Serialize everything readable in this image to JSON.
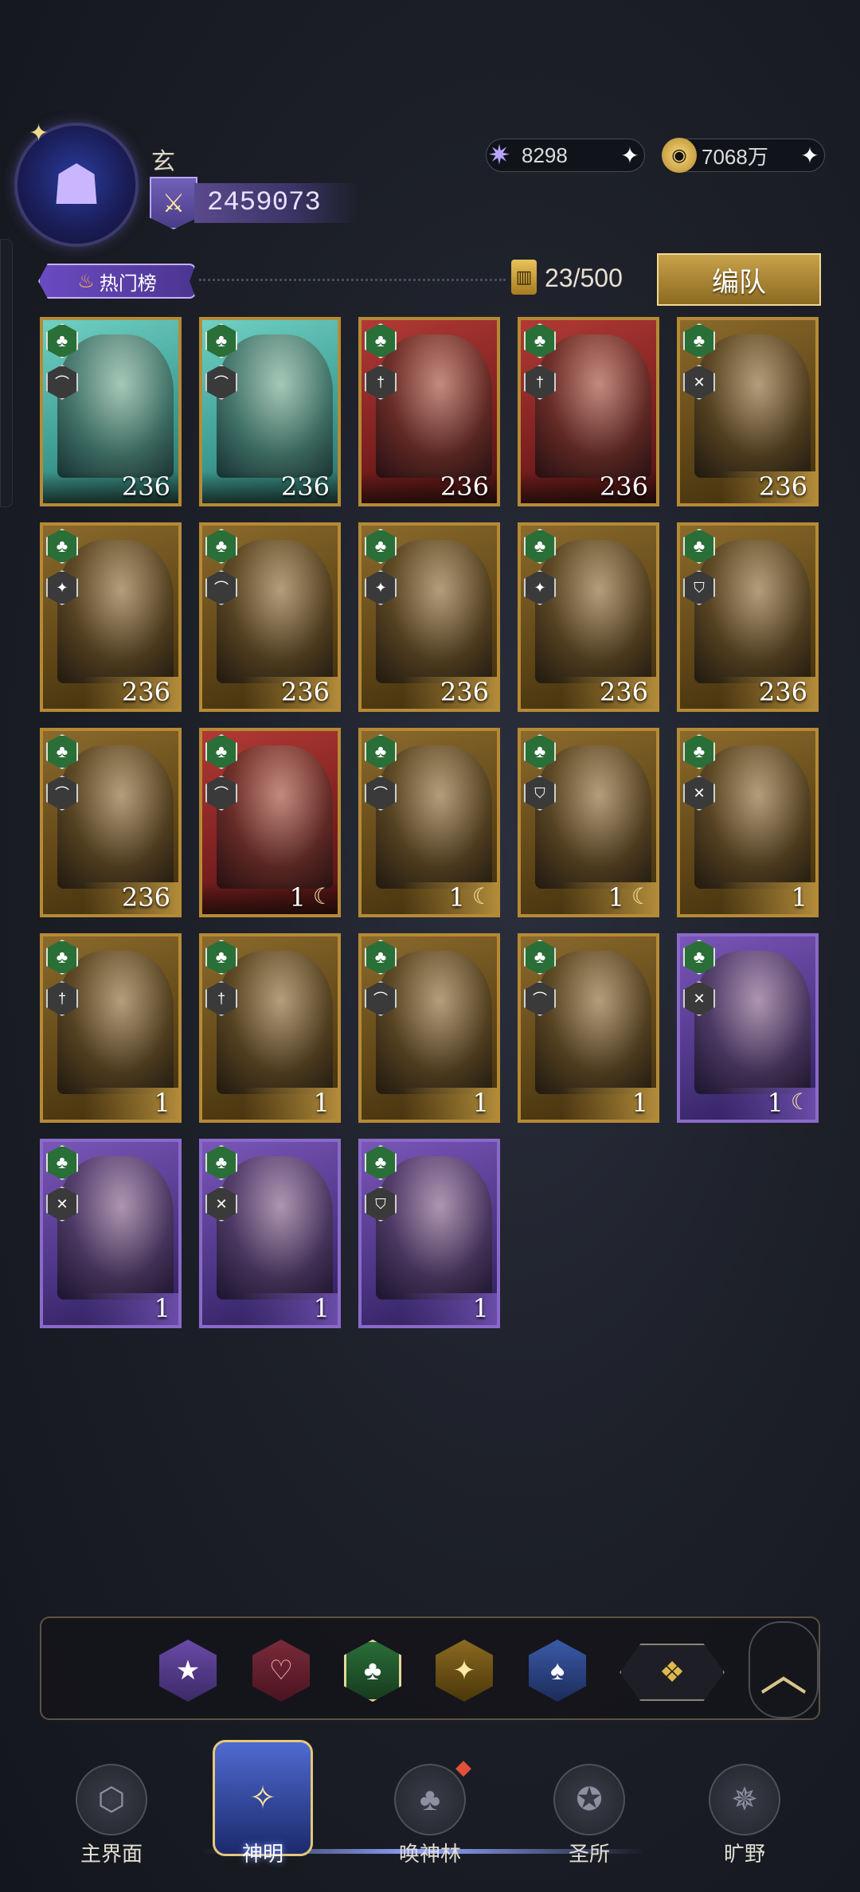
{
  "header": {
    "player_name": "玄",
    "avatar_icon": "hooded-figure-icon",
    "power": "2459073",
    "gems": "8298",
    "gold": "7068万"
  },
  "section": {
    "tab_label": "热门榜",
    "card_count": "23/500",
    "formation_button": "编队"
  },
  "colors": {
    "accent_gold": "#b68a35",
    "suit_green": "#2a6e38",
    "purple_rarity": "#6a4ca8",
    "teal_rarity": "#3c9c92",
    "red_rarity": "#7a1f1f"
  },
  "cards": [
    {
      "level": "236",
      "frame": "teal",
      "role": "bow-icon",
      "badge": ""
    },
    {
      "level": "236",
      "frame": "teal",
      "role": "bow-icon",
      "badge": ""
    },
    {
      "level": "236",
      "frame": "red",
      "role": "dagger-icon",
      "badge": ""
    },
    {
      "level": "236",
      "frame": "red",
      "role": "dagger-icon",
      "badge": ""
    },
    {
      "level": "236",
      "frame": "gold",
      "role": "swords-icon",
      "badge": ""
    },
    {
      "level": "236",
      "frame": "gold",
      "role": "star-icon",
      "badge": ""
    },
    {
      "level": "236",
      "frame": "gold",
      "role": "bow-icon",
      "badge": ""
    },
    {
      "level": "236",
      "frame": "gold",
      "role": "star-icon",
      "badge": ""
    },
    {
      "level": "236",
      "frame": "gold",
      "role": "star-icon",
      "badge": ""
    },
    {
      "level": "236",
      "frame": "gold",
      "role": "shield-icon",
      "badge": ""
    },
    {
      "level": "236",
      "frame": "gold",
      "role": "bow-icon",
      "badge": ""
    },
    {
      "level": "1",
      "frame": "red",
      "role": "bow-icon",
      "badge": "moon"
    },
    {
      "level": "1",
      "frame": "gold",
      "role": "bow-icon",
      "badge": "moon"
    },
    {
      "level": "1",
      "frame": "gold",
      "role": "shield-icon",
      "badge": "moon"
    },
    {
      "level": "1",
      "frame": "gold",
      "role": "swords-icon",
      "badge": ""
    },
    {
      "level": "1",
      "frame": "gold",
      "role": "dagger-icon",
      "badge": ""
    },
    {
      "level": "1",
      "frame": "gold",
      "role": "dagger-icon",
      "badge": ""
    },
    {
      "level": "1",
      "frame": "gold",
      "role": "bow-icon",
      "badge": ""
    },
    {
      "level": "1",
      "frame": "gold",
      "role": "bow-icon",
      "badge": ""
    },
    {
      "level": "1",
      "frame": "purple",
      "role": "swords-icon",
      "badge": "moon"
    },
    {
      "level": "1",
      "frame": "purple",
      "role": "swords-icon",
      "badge": ""
    },
    {
      "level": "1",
      "frame": "purple",
      "role": "swords-icon",
      "badge": ""
    },
    {
      "level": "1",
      "frame": "purple",
      "role": "shield-icon",
      "badge": ""
    }
  ],
  "filters": [
    {
      "icon": "star-suit-icon"
    },
    {
      "icon": "heart-suit-icon"
    },
    {
      "icon": "club-suit-icon",
      "selected": true
    },
    {
      "icon": "diamond-suit-icon"
    },
    {
      "icon": "spade-suit-icon"
    },
    {
      "icon": "all-suits-icon"
    }
  ],
  "nav": {
    "items": [
      {
        "label": "主界面",
        "icon": "main-world-icon"
      },
      {
        "label": "神明",
        "icon": "god-card-icon",
        "active": true
      },
      {
        "label": "唤神林",
        "icon": "tree-icon"
      },
      {
        "label": "圣所",
        "icon": "sanctuary-icon"
      },
      {
        "label": "旷野",
        "icon": "compass-icon"
      }
    ]
  }
}
